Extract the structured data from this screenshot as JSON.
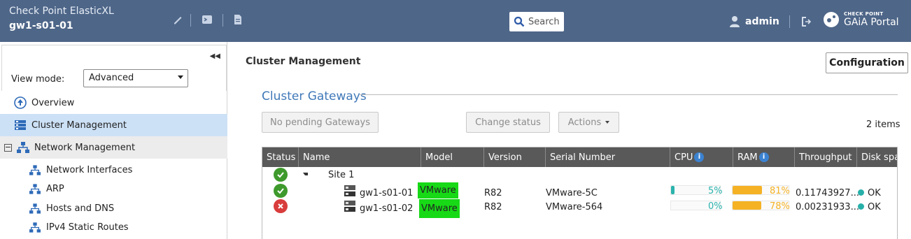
{
  "header": {
    "app_name": "Check Point ElasticXL",
    "host": "gw1-s01-01",
    "search_label": "Search",
    "user": "admin",
    "portal_line1": "CHECK POINT",
    "portal_line2": "GAiA Portal"
  },
  "sidebar": {
    "view_mode_label": "View mode:",
    "view_mode_value": "Advanced",
    "items": [
      {
        "label": "Overview"
      },
      {
        "label": "Cluster Management"
      },
      {
        "label": "Network Management"
      }
    ],
    "sub_items": [
      {
        "label": "Network Interfaces"
      },
      {
        "label": "ARP"
      },
      {
        "label": "Hosts and DNS"
      },
      {
        "label": "IPv4 Static Routes"
      }
    ]
  },
  "main": {
    "page_title": "Cluster Management",
    "config_button": "Configuration",
    "section_title": "Cluster Gateways",
    "btn_pending": "No pending Gateways",
    "btn_change_status": "Change status",
    "btn_actions": "Actions",
    "item_count": "2 items",
    "columns": [
      "Status",
      "Name",
      "Model",
      "Version",
      "Serial Number",
      "CPU",
      "RAM",
      "Throughput",
      "Disk spa"
    ],
    "site_row": {
      "label": "Site 1"
    },
    "rows": [
      {
        "status": "ok",
        "name": "gw1-s01-01",
        "model": "VMware",
        "version": "R82",
        "serial": "VMware-5C",
        "cpu_pct": 5,
        "cpu_label": "5%",
        "ram_pct": 81,
        "ram_label": "81%",
        "throughput": "0.11743927...",
        "disk": "OK"
      },
      {
        "status": "error",
        "name": "gw1-s01-02",
        "model": "VMware",
        "version": "R82",
        "serial": "VMware-564",
        "cpu_pct": 0,
        "cpu_label": "0%",
        "ram_pct": 78,
        "ram_label": "78%",
        "throughput": "0.00231933...",
        "disk": "OK"
      }
    ]
  },
  "colors": {
    "header_bg": "#4e6688",
    "accent": "#3f78b8",
    "cpu_fill": "#2bb3ad",
    "ram_fill": "#f5b225",
    "ok": "#3e9a2c",
    "error": "#d93c3c",
    "highlight": "#17d916"
  }
}
